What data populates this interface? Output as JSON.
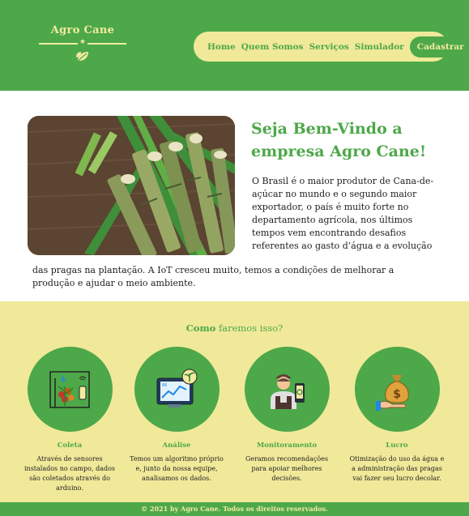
{
  "brand": {
    "name": "Agro Cane",
    "star": "★",
    "leaf_icon": "leaf-icon"
  },
  "nav": {
    "items": [
      "Home",
      "Quem Somos",
      "Serviços",
      "Simulador"
    ],
    "cta": "Cadastrar"
  },
  "welcome": {
    "title": "Seja Bem-Vindo a empresa Agro Cane!",
    "text_part1": "O Brasil é o maior produtor de Cana-de-açúcar no mundo e o segundo maior exportador, o país é muito forte no departamento agrícola, nos últimos tempos vem encontrando desafios referentes ao gasto d’água e a evolução",
    "text_part2": "das pragas na plantação. A IoT cresceu muito, temos a condições de melhorar a produção e ajudar o meio ambiente.",
    "image_icon": "sugarcane-photo"
  },
  "how": {
    "title_bold": "Como",
    "title_rest": " faremos isso?",
    "cards": [
      {
        "icon": "sensor-plant-icon",
        "title": "Coleta",
        "text": "Através de sensores instalados no campo, dados são coletados através do arduino."
      },
      {
        "icon": "analytics-monitor-icon",
        "title": "Análise",
        "text": "Temos um algoritmo próprio e, junto da nossa equipe, analisamos os dados."
      },
      {
        "icon": "farmer-phone-icon",
        "title": "Monitoramento",
        "text": "Geramos recomendações para apoiar melhores decisões."
      },
      {
        "icon": "money-bag-hand-icon",
        "title": "Lucro",
        "text": "Otimização do uso da água e a administração das pragas vai fazer seu lucro decolar."
      }
    ]
  },
  "footer": {
    "text": "© 2021 by Agro Cane. Todos os direitos reservados."
  },
  "colors": {
    "green": "#4da849",
    "cream": "#f0e99a",
    "text": "#1e1e1e"
  }
}
